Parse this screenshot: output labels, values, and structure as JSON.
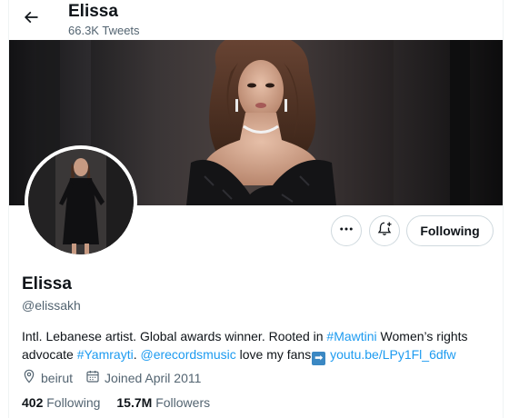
{
  "header": {
    "name": "Elissa",
    "tweet_count": "66.3K Tweets"
  },
  "profile": {
    "name": "Elissa",
    "handle": "@elissakh",
    "bio": {
      "text1": "Intl. Lebanese artist. Global awards winner. Rooted in ",
      "hashtag1": "#Mawtini",
      "text2": " Women’s rights advocate ",
      "hashtag2": "#Yamrayti",
      "text3": ". ",
      "mention": "@erecordsmusic",
      "text4": " love my fans",
      "arrow": "➡",
      "link": "youtu.be/LPy1Fl_6dfw"
    },
    "location": "beirut",
    "joined": "Joined April 2011",
    "following_count": "402",
    "following_label": "Following",
    "followers_count": "15.7M",
    "followers_label": "Followers"
  },
  "actions": {
    "following_button": "Following"
  },
  "icons": {
    "back": "arrow-left-icon",
    "more": "more-icon",
    "notify": "bell-plus-icon",
    "location": "location-pin-icon",
    "calendar": "calendar-icon"
  },
  "colors": {
    "link": "#1d9bf0",
    "secondary_text": "#536471",
    "primary_text": "#0f1419",
    "border": "#cfd9de"
  }
}
